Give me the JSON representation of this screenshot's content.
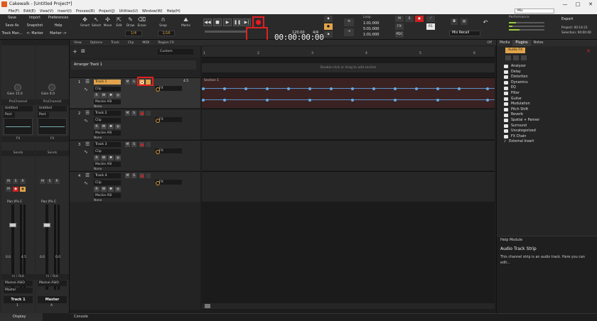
{
  "window": {
    "title": "Cakewalk - [Untitled Project*]",
    "controls": [
      "—",
      "□",
      "✕"
    ]
  },
  "menu": {
    "items": [
      "File(F)",
      "Edit(E)",
      "View(V)",
      "Insert(I)",
      "Process(R)",
      "Project(J)",
      "Utilities(U)",
      "Window(W)",
      "Help(H)"
    ],
    "mix_preset": "Mix"
  },
  "left_buttons": {
    "save": "Save",
    "import": "Import",
    "preferences": "Preferences",
    "save_as": "Save As",
    "snapshot": "Snapshot",
    "help": "Help",
    "track_man": "Track Man...",
    "marker_prev": "<- Marker",
    "marker_next": "Marker ->"
  },
  "tools": {
    "smart": "Smart",
    "select": "Select",
    "move": "Move",
    "edit": "Edit",
    "draw": "Draw",
    "erase": "Erase",
    "snap": "Snap",
    "marks": "Marks",
    "snap_value": "1/4",
    "grid_value": "1/16"
  },
  "transport": {
    "time": "00:00:00:00",
    "tempo": "120.00",
    "meter": "4/4",
    "loop_label": "Loop",
    "loop_start": "1:01:000",
    "loop_end": "5:01:000",
    "punch_start": "1:01:000",
    "punch_end": "1:01:000"
  },
  "mix": {
    "fx": "FX",
    "pdc": "PDC",
    "rec_button": "R1",
    "mix_recall": "Mix Recall"
  },
  "performance": {
    "label": "Performance",
    "export": "Export",
    "project_info": "Project: 00:14:21",
    "selection_info": "Selection: 00:00:00"
  },
  "inspector": {
    "strip1": {
      "gain": "Gain 15.0",
      "prochannel": "ProChannel",
      "preset": "Untitled",
      "post": "Post",
      "fx": "FX",
      "sends": "Sends",
      "pan": "Pan 0% C",
      "io": "In / Out",
      "input": "Mackie ASIO",
      "output": "Master",
      "name": "Track 1",
      "number": "1",
      "db_left": "0.0",
      "db_right": "4.5"
    },
    "strip2": {
      "gain": "Gain 0.0",
      "pan_label": "Pan C",
      "prochannel": "ProChannel",
      "preset": "Untitled",
      "post": "Post",
      "fx": "FX",
      "sends": "Sends",
      "pan": "Pan 0% C",
      "io": "In / Out",
      "input": "Mackie ASIO",
      "output": "",
      "name": "Master",
      "number": "A",
      "db_left": "0.0",
      "db_right": "0.0"
    },
    "display_tab": "Display"
  },
  "trackview": {
    "menu": [
      "View",
      "Options",
      "Track",
      "Clip",
      "MIDI",
      "Region FX"
    ],
    "extra_menu": "Off",
    "custom": "Custom",
    "arranger_label": "Arranger Track 1",
    "arranger_hint": "Double-click or drag to add section",
    "section_name": "Section 1",
    "ruler": [
      "1",
      "2",
      "3",
      "4",
      "5",
      "6",
      "7",
      "8"
    ],
    "tracks": [
      {
        "num": "1",
        "name": "Track 1",
        "clip": "Clip",
        "fx": "FX",
        "input": "Mackie ASI",
        "output": "None",
        "vol": "4.5"
      },
      {
        "num": "2",
        "name": "Track 2",
        "clip": "Clip",
        "fx": "FX",
        "input": "Mackie ASI",
        "output": "None",
        "vol": ""
      },
      {
        "num": "3",
        "name": "Track 3",
        "clip": "Clip",
        "fx": "FX",
        "input": "Mackie ASI",
        "output": "None",
        "vol": ""
      },
      {
        "num": "4",
        "name": "Track 4",
        "clip": "Clip",
        "fx": "FX",
        "input": "Mackie ASI",
        "output": "None",
        "vol": ""
      }
    ],
    "bottom_tab": "Console"
  },
  "browser": {
    "tabs": [
      "Media",
      "Plugins",
      "Notes"
    ],
    "active_tab": "Plugins",
    "category": "Audio FX",
    "tree": [
      "Analyzer",
      "Delay",
      "Distortion",
      "Dynamics",
      "EQ",
      "Filter",
      "Guitar",
      "Modulation",
      "Pitch Shift",
      "Reverb",
      "Spatial + Panner",
      "Surround",
      "Uncategorized",
      "FX Chain",
      "External Insert"
    ],
    "help_title": "Help Module",
    "help_heading": "Audio Track Strip",
    "help_body": "This channel strip is an audio track. Here you can edit..."
  },
  "colors": {
    "accent": "#e1a44a",
    "record": "#e51c23",
    "highlight": "#e02020",
    "automation": "#5a8fc5"
  }
}
